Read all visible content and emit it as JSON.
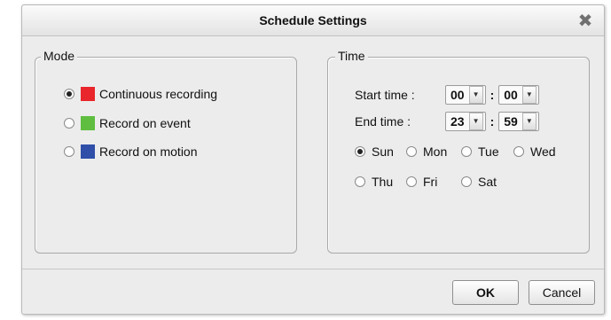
{
  "dialog": {
    "title": "Schedule Settings",
    "close_glyph": "✖"
  },
  "mode": {
    "legend": "Mode",
    "options": [
      {
        "label": "Continuous recording",
        "color": "#e8262b",
        "checked": true
      },
      {
        "label": "Record on event",
        "color": "#5fbe3f",
        "checked": false
      },
      {
        "label": "Record on motion",
        "color": "#2f4fa8",
        "checked": false
      }
    ]
  },
  "time": {
    "legend": "Time",
    "start_label": "Start time :",
    "end_label": "End time :",
    "start_hour": "00",
    "start_minute": "00",
    "end_hour": "23",
    "end_minute": "59",
    "separator": ":",
    "days": [
      {
        "label": "Sun",
        "checked": true
      },
      {
        "label": "Mon",
        "checked": false
      },
      {
        "label": "Tue",
        "checked": false
      },
      {
        "label": "Wed",
        "checked": false
      },
      {
        "label": "Thu",
        "checked": false
      },
      {
        "label": "Fri",
        "checked": false
      },
      {
        "label": "Sat",
        "checked": false
      }
    ]
  },
  "buttons": {
    "ok": "OK",
    "cancel": "Cancel"
  }
}
